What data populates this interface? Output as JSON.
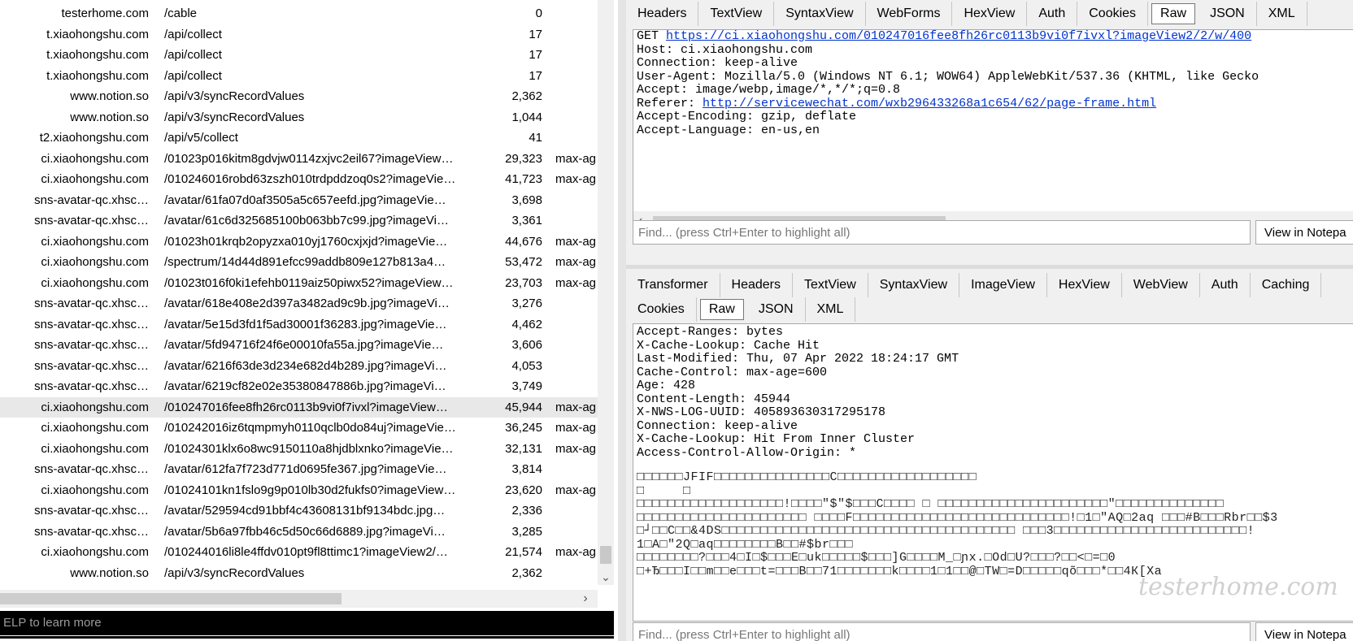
{
  "sessions": [
    {
      "host": "testerhome.com",
      "url": "/cable",
      "body": "0",
      "caching": ""
    },
    {
      "host": "t.xiaohongshu.com",
      "url": "/api/collect",
      "body": "17",
      "caching": ""
    },
    {
      "host": "t.xiaohongshu.com",
      "url": "/api/collect",
      "body": "17",
      "caching": ""
    },
    {
      "host": "t.xiaohongshu.com",
      "url": "/api/collect",
      "body": "17",
      "caching": ""
    },
    {
      "host": "www.notion.so",
      "url": "/api/v3/syncRecordValues",
      "body": "2,362",
      "caching": ""
    },
    {
      "host": "www.notion.so",
      "url": "/api/v3/syncRecordValues",
      "body": "1,044",
      "caching": ""
    },
    {
      "host": "t2.xiaohongshu.com",
      "url": "/api/v5/collect",
      "body": "41",
      "caching": ""
    },
    {
      "host": "ci.xiaohongshu.com",
      "url": "/01023p016kitm8gdvjw0114zxjvc2eil67?imageView…",
      "body": "29,323",
      "caching": "max-ag"
    },
    {
      "host": "ci.xiaohongshu.com",
      "url": "/010246016robd63zszh010trdpddzoq0s2?imageVie…",
      "body": "41,723",
      "caching": "max-ag"
    },
    {
      "host": "sns-avatar-qc.xhsc…",
      "url": "/avatar/61fa07d0af3505a5c657eefd.jpg?imageVie…",
      "body": "3,698",
      "caching": ""
    },
    {
      "host": "sns-avatar-qc.xhsc…",
      "url": "/avatar/61c6d325685100b063bb7c99.jpg?imageVi…",
      "body": "3,361",
      "caching": ""
    },
    {
      "host": "ci.xiaohongshu.com",
      "url": "/01023h01krqb2opyzxa010yj1760cxjxjd?imageVie…",
      "body": "44,676",
      "caching": "max-ag"
    },
    {
      "host": "ci.xiaohongshu.com",
      "url": "/spectrum/14d44d891efcc99addb809e127b813a4…",
      "body": "53,472",
      "caching": "max-ag"
    },
    {
      "host": "ci.xiaohongshu.com",
      "url": "/01023t016f0ki1efehb0119aiz50piwx52?imageView…",
      "body": "23,703",
      "caching": "max-ag"
    },
    {
      "host": "sns-avatar-qc.xhsc…",
      "url": "/avatar/618e408e2d397a3482ad9c9b.jpg?imageVi…",
      "body": "3,276",
      "caching": ""
    },
    {
      "host": "sns-avatar-qc.xhsc…",
      "url": "/avatar/5e15d3fd1f5ad30001f36283.jpg?imageVie…",
      "body": "4,462",
      "caching": ""
    },
    {
      "host": "sns-avatar-qc.xhsc…",
      "url": "/avatar/5fd94716f24f6e00010fa55a.jpg?imageVie…",
      "body": "3,606",
      "caching": ""
    },
    {
      "host": "sns-avatar-qc.xhsc…",
      "url": "/avatar/6216f63de3d234e682d4b289.jpg?imageVi…",
      "body": "4,053",
      "caching": ""
    },
    {
      "host": "sns-avatar-qc.xhsc…",
      "url": "/avatar/6219cf82e02e35380847886b.jpg?imageVi…",
      "body": "3,749",
      "caching": ""
    },
    {
      "host": "ci.xiaohongshu.com",
      "url": "/010247016fee8fh26rc0113b9vi0f7ivxl?imageView…",
      "body": "45,944",
      "caching": "max-ag",
      "selected": true
    },
    {
      "host": "ci.xiaohongshu.com",
      "url": "/010242016iz6tqmpmyh0110qclb0do84uj?imageVie…",
      "body": "36,245",
      "caching": "max-ag"
    },
    {
      "host": "ci.xiaohongshu.com",
      "url": "/01024301klx6o8wc9150110a8hjdblxnko?imageVie…",
      "body": "32,131",
      "caching": "max-ag"
    },
    {
      "host": "sns-avatar-qc.xhsc…",
      "url": "/avatar/612fa7f723d771d0695fe367.jpg?imageVie…",
      "body": "3,814",
      "caching": ""
    },
    {
      "host": "ci.xiaohongshu.com",
      "url": "/01024101kn1fslo9g9p010lb30d2fukfs0?imageView…",
      "body": "23,620",
      "caching": "max-ag"
    },
    {
      "host": "sns-avatar-qc.xhsc…",
      "url": "/avatar/529594cd91bbf4c43608131bf9134bdc.jpg…",
      "body": "2,336",
      "caching": ""
    },
    {
      "host": "sns-avatar-qc.xhsc…",
      "url": "/avatar/5b6a97fbb46c5d50c66d6889.jpg?imageVi…",
      "body": "3,285",
      "caching": ""
    },
    {
      "host": "ci.xiaohongshu.com",
      "url": "/010244016li8le4ffdv010pt9fl8ttimc1?imageView2/…",
      "body": "21,574",
      "caching": "max-ag"
    },
    {
      "host": "www.notion.so",
      "url": "/api/v3/syncRecordValues",
      "body": "2,362",
      "caching": ""
    }
  ],
  "quickexec": "ELP to learn more",
  "request_tabs": [
    "Headers",
    "TextView",
    "SyntaxView",
    "WebForms",
    "HexView",
    "Auth",
    "Cookies",
    "Raw",
    "JSON",
    "XML"
  ],
  "request_active_tab": "Raw",
  "request_raw": {
    "method": "GET ",
    "url": "https://ci.xiaohongshu.com/010247016fee8fh26rc0113b9vi0f7ivxl?imageView2/2/w/400",
    "lines_before_referer": [
      "Host: ci.xiaohongshu.com",
      "Connection: keep-alive",
      "User-Agent: Mozilla/5.0 (Windows NT 6.1; WOW64) AppleWebKit/537.36 (KHTML, like Gecko",
      "Accept: image/webp,image/*,*/*;q=0.8"
    ],
    "referer_label": "Referer: ",
    "referer_url": "http://servicewechat.com/wxb296433268a1c654/62/page-frame.html",
    "lines_after_referer": [
      "Accept-Encoding: gzip, deflate",
      "Accept-Language: en-us,en"
    ]
  },
  "find_placeholder": "Find... (press Ctrl+Enter to highlight all)",
  "view_in_notepad": "View in Notepa",
  "response_tabs_row1": [
    "Transformer",
    "Headers",
    "TextView",
    "SyntaxView",
    "ImageView",
    "HexView",
    "WebView",
    "Auth",
    "Caching"
  ],
  "response_tabs_row2": [
    "Cookies",
    "Raw",
    "JSON",
    "XML"
  ],
  "response_active_tab": "Raw",
  "response_headers": [
    "Accept-Ranges: bytes",
    "X-Cache-Lookup: Cache Hit",
    "Last-Modified: Thu, 07 Apr 2022 18:24:17 GMT",
    "Cache-Control: max-age=600",
    "Age: 428",
    "Content-Length: 45944",
    "X-NWS-LOG-UUID: 405893630317295178",
    "Connection: keep-alive",
    "X-Cache-Lookup: Hit From Inner Cluster",
    "Access-Control-Allow-Origin: *"
  ],
  "response_binary": [
    "□□□□□□JFIF□□□□□□□□□□□□□□□C□□□□□□□□□□□□□□□□□□",
    "□     □",
    "",
    "",
    "□□□□□□□□□□□□□□□□□□□!□□□□\"$\"$□□□C□□□□ □ □□□□□□□□□□□□□□□□□□□□□□\"□□□□□□□□□□□□□□",
    "□□□□□□□□□□□□□□□□□□□□□□ □□□□F□□□□□□□□□□□□□□□□□□□□□□□□□□□□!□1□\"AQ□2aq □□□#B□□□Rbr□□$3",
    "□┘□□C□□&4DS□□□□□□□□□□□□□□□□□□□□□□□□□□□□□□□□□□□□□□ □□□3□□□□□□□□□□□□□□□□□□□□□□□□□!",
    "1□A□\"2Q□aq□□□□□□□□B□□#$br□□□",
    "□□□□□□□□?□□□4□I□$□□□E□uk□□□□□$□□□]G□□□□M_□ɲx.□Od□U?□□□?□□<□=□0",
    "□+Ђ□□□I□□m□□e□□□t=□□□B□□71□□□□□□□k□□□□1□1□□@□TW□=D□□□□□qõ□□□*□□4К[Xa"
  ],
  "watermark": "testerhome.com"
}
